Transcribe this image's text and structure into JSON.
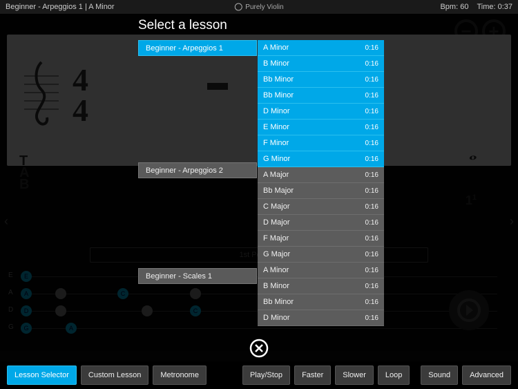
{
  "top": {
    "lesson": "Beginner - Arpeggios 1",
    "sep": "  |  ",
    "key": "A Minor",
    "brand": "Purely Violin",
    "bpm_label": "Bpm: 60",
    "time_label": "Time: 0:37"
  },
  "bg": {
    "position_label": "1st Position",
    "tab_letters": "T\nA\nB",
    "one_label": "1",
    "one_sup": "1",
    "string_labels": [
      "E",
      "A",
      "D",
      "G"
    ]
  },
  "modal": {
    "title": "Select a lesson",
    "categories": [
      {
        "label": "Beginner - Arpeggios 1",
        "selected": true
      },
      {
        "label": "Beginner - Arpeggios 2",
        "selected": false
      },
      {
        "label": "Beginner - Scales 1",
        "selected": false
      }
    ],
    "lessons": [
      {
        "name": "A Minor",
        "dur": "0:16",
        "hl": true
      },
      {
        "name": "B Minor",
        "dur": "0:16",
        "hl": true
      },
      {
        "name": "Bb Minor",
        "dur": "0:16",
        "hl": true
      },
      {
        "name": "Bb Minor",
        "dur": "0:16",
        "hl": true
      },
      {
        "name": "D Minor",
        "dur": "0:16",
        "hl": true
      },
      {
        "name": "E Minor",
        "dur": "0:16",
        "hl": true
      },
      {
        "name": "F Minor",
        "dur": "0:16",
        "hl": true
      },
      {
        "name": "G Minor",
        "dur": "0:16",
        "hl": true
      },
      {
        "name": "A Major",
        "dur": "0:16",
        "hl": false
      },
      {
        "name": "Bb Major",
        "dur": "0:16",
        "hl": false
      },
      {
        "name": "C Major",
        "dur": "0:16",
        "hl": false
      },
      {
        "name": "D Major",
        "dur": "0:16",
        "hl": false
      },
      {
        "name": "F Major",
        "dur": "0:16",
        "hl": false
      },
      {
        "name": "G Major",
        "dur": "0:16",
        "hl": false
      },
      {
        "name": "A Minor",
        "dur": "0:16",
        "hl": false
      },
      {
        "name": "B Minor",
        "dur": "0:16",
        "hl": false
      },
      {
        "name": "Bb Minor",
        "dur": "0:16",
        "hl": false
      },
      {
        "name": "D Minor",
        "dur": "0:16",
        "hl": false
      }
    ]
  },
  "toolbar": {
    "lesson_selector": "Lesson Selector",
    "custom_lesson": "Custom Lesson",
    "metronome": "Metronome",
    "play_stop": "Play/Stop",
    "faster": "Faster",
    "slower": "Slower",
    "loop": "Loop",
    "sound": "Sound",
    "advanced": "Advanced"
  }
}
